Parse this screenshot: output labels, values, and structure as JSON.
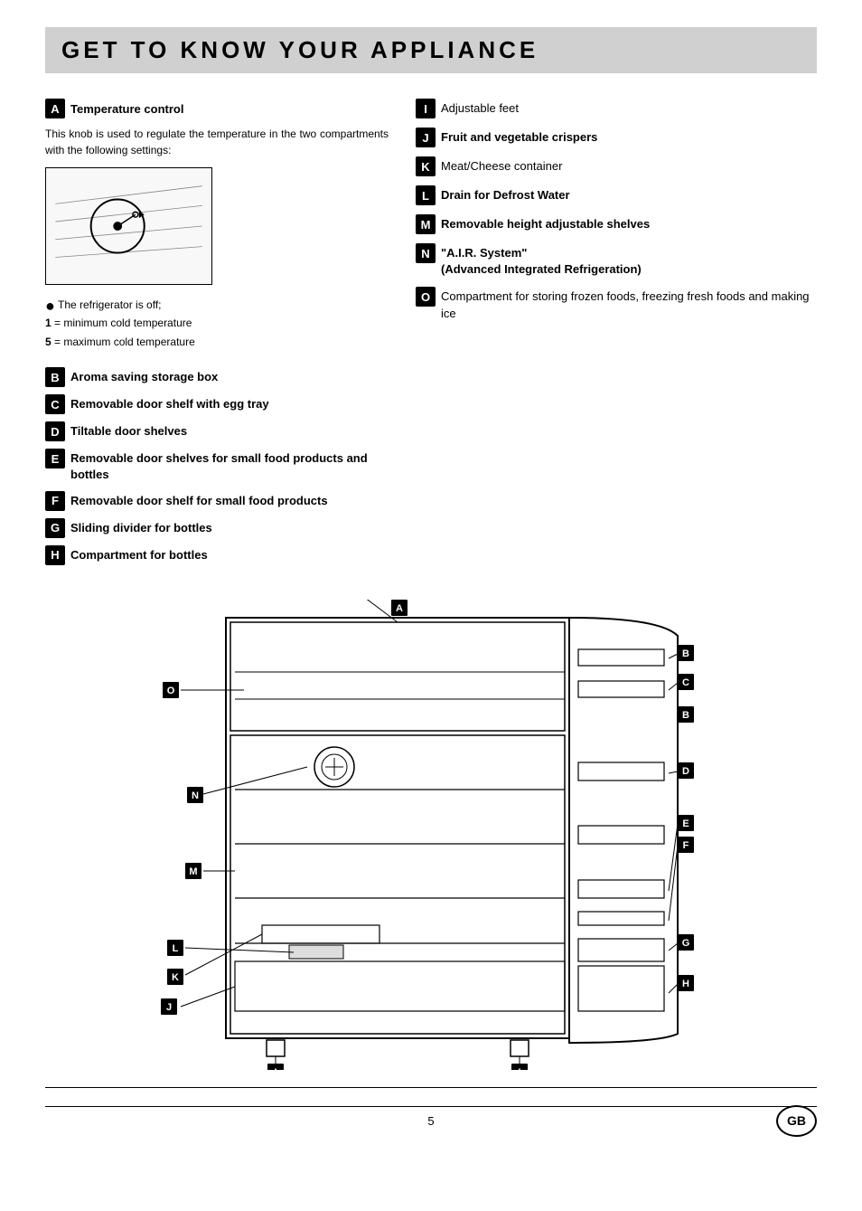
{
  "title": "GET TO KNOW YOUR APPLIANCE",
  "section_a": {
    "badge": "A",
    "heading": "Temperature control",
    "description": "This knob is used to regulate the temperature in the two compartments with the following settings:",
    "notes": [
      "● The refrigerator is off;",
      "1 = minimum cold temperature",
      "5 = maximum cold temperature"
    ]
  },
  "right_items": [
    {
      "badge": "I",
      "text": "Adjustable feet",
      "bold": true
    },
    {
      "badge": "J",
      "text": "Fruit and vegetable crispers",
      "bold": true
    },
    {
      "badge": "K",
      "text": "Meat/Cheese container",
      "bold": true
    },
    {
      "badge": "L",
      "text": "Drain for Defrost Water",
      "bold": true
    },
    {
      "badge": "M",
      "text": "Removable height adjustable shelves",
      "bold": true
    },
    {
      "badge": "N",
      "text": "\"A.I.R. System\"",
      "subtext": "(Advanced Integrated Refrigeration)",
      "bold": true
    },
    {
      "badge": "O",
      "text": "Compartment for storing frozen foods, freezing fresh foods and making ice",
      "bold": false
    }
  ],
  "left_items": [
    {
      "badge": "B",
      "text": "Aroma saving storage box"
    },
    {
      "badge": "C",
      "text": "Removable door shelf with egg tray"
    },
    {
      "badge": "D",
      "text": "Tiltable door shelves"
    },
    {
      "badge": "E",
      "text": "Removable door shelves for small food products and bottles"
    },
    {
      "badge": "F",
      "text": "Removable door shelf for small food products"
    },
    {
      "badge": "G",
      "text": "Sliding divider for bottles"
    },
    {
      "badge": "H",
      "text": "Compartment for bottles"
    }
  ],
  "footer": {
    "page": "5",
    "gb_label": "GB"
  }
}
